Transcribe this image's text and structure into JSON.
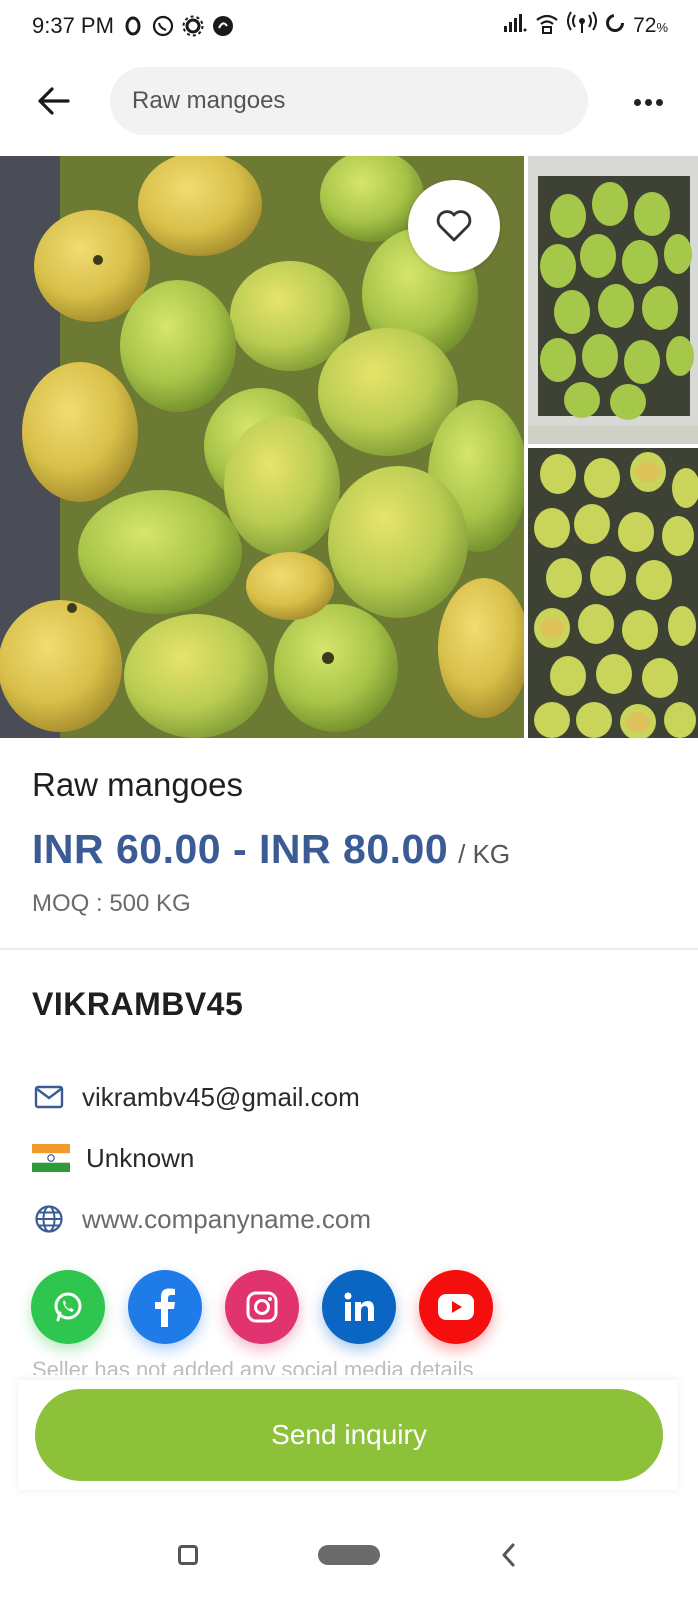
{
  "status_bar": {
    "time": "9:37 PM",
    "battery": "72",
    "battery_unit": "%"
  },
  "header": {
    "search_value": "Raw mangoes"
  },
  "product": {
    "title": "Raw mangoes",
    "price": "INR 60.00 - INR 80.00",
    "price_unit": "/ KG",
    "moq": "MOQ : 500 KG"
  },
  "seller": {
    "name": "VIKRAMBV45",
    "email": "vikrambv45@gmail.com",
    "country": "Unknown",
    "website": "www.companyname.com",
    "social_note": "Seller has not added any social media details"
  },
  "socials": [
    {
      "name": "whatsapp",
      "color": "#2fc64f"
    },
    {
      "name": "facebook",
      "color": "#1f7be8"
    },
    {
      "name": "instagram",
      "color": "#e13370"
    },
    {
      "name": "linkedin",
      "color": "#0a66c2"
    },
    {
      "name": "youtube",
      "color": "#f50e0e"
    }
  ],
  "actions": {
    "inquiry_label": "Send inquiry"
  },
  "colors": {
    "price": "#3b5b94",
    "accent": "#8cc139"
  }
}
